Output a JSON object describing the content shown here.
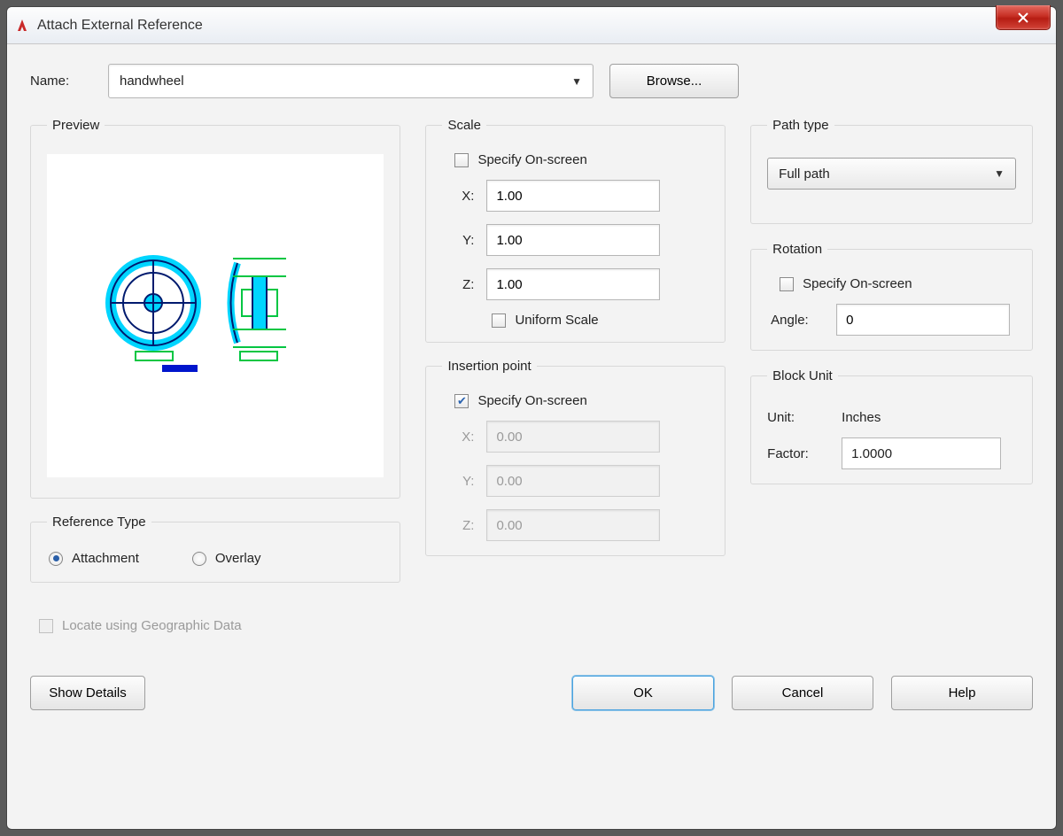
{
  "window": {
    "title": "Attach External Reference"
  },
  "name_row": {
    "label": "Name:",
    "value": "handwheel",
    "browse": "Browse..."
  },
  "preview": {
    "legend": "Preview"
  },
  "reference_type": {
    "legend": "Reference Type",
    "attachment": "Attachment",
    "overlay": "Overlay",
    "selected": "attachment"
  },
  "locate_geo": {
    "label": "Locate using Geographic Data",
    "enabled": false,
    "checked": false
  },
  "scale": {
    "legend": "Scale",
    "specify_label": "Specify On-screen",
    "specify_checked": false,
    "x_label": "X:",
    "x_value": "1.00",
    "y_label": "Y:",
    "y_value": "1.00",
    "z_label": "Z:",
    "z_value": "1.00",
    "uniform_label": "Uniform Scale",
    "uniform_checked": false
  },
  "insertion": {
    "legend": "Insertion point",
    "specify_label": "Specify On-screen",
    "specify_checked": true,
    "x_label": "X:",
    "x_value": "0.00",
    "y_label": "Y:",
    "y_value": "0.00",
    "z_label": "Z:",
    "z_value": "0.00"
  },
  "path_type": {
    "legend": "Path type",
    "value": "Full path"
  },
  "rotation": {
    "legend": "Rotation",
    "specify_label": "Specify On-screen",
    "specify_checked": false,
    "angle_label": "Angle:",
    "angle_value": "0"
  },
  "block_unit": {
    "legend": "Block Unit",
    "unit_label": "Unit:",
    "unit_value": "Inches",
    "factor_label": "Factor:",
    "factor_value": "1.0000"
  },
  "buttons": {
    "show_details": "Show Details",
    "ok": "OK",
    "cancel": "Cancel",
    "help": "Help"
  }
}
